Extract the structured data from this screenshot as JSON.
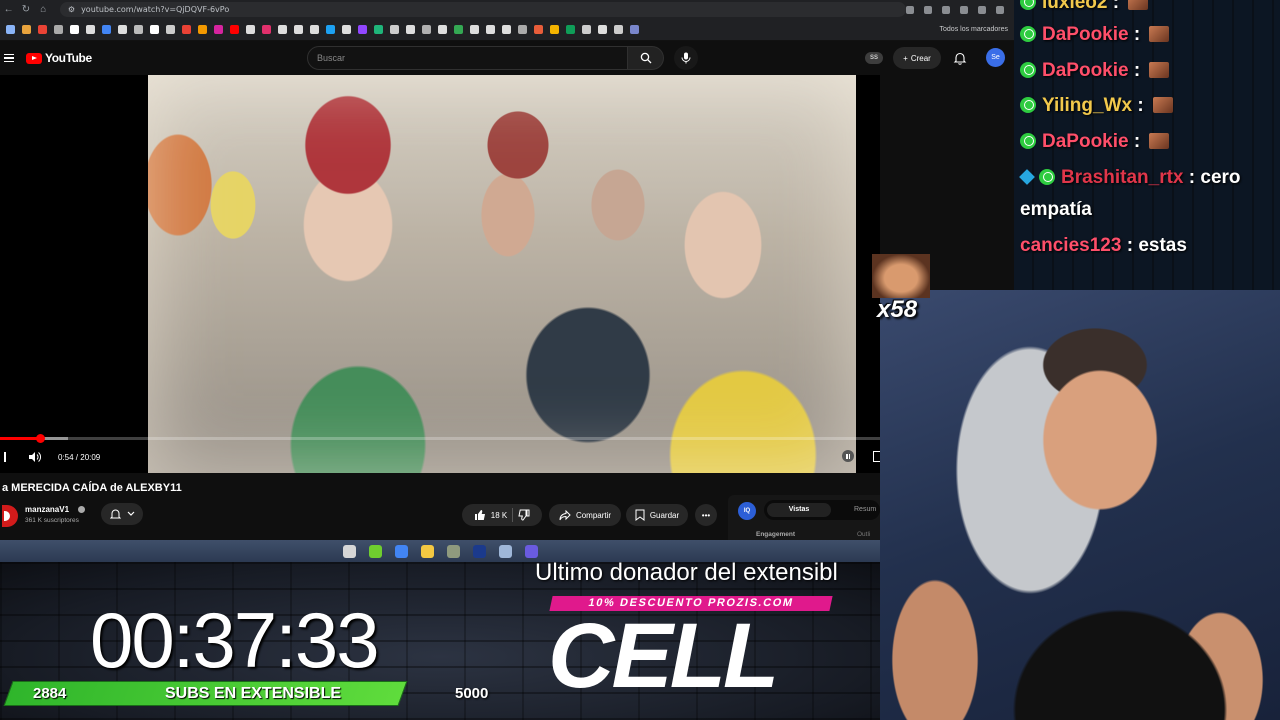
{
  "browser": {
    "url": "youtube.com/watch?v=QjDQVF-6vPo",
    "bookmarks_all": "Todos los marcadores",
    "bookmark_colors": [
      "#8ab4f8",
      "#e8a33d",
      "#ea4335",
      "#aaaaaa",
      "#ffffff",
      "#dddddd",
      "#4285f4",
      "#dddddd",
      "#bbbbbb",
      "#ffffff",
      "#cccccc",
      "#e94235",
      "#f29900",
      "#d6249f",
      "#ff0000",
      "#dddddd",
      "#e1306c",
      "#dddddd",
      "#dddddd",
      "#dddddd",
      "#1da1f2",
      "#dddddd",
      "#9146ff",
      "#1fb57a",
      "#cccccc",
      "#dddddd",
      "#b0b0b0",
      "#dddddd",
      "#34a853",
      "#dddddd",
      "#dddddd",
      "#dddddd",
      "#aaaaaa",
      "#e85d3a",
      "#f4b400",
      "#0f9d58",
      "#cccccc",
      "#dddddd",
      "#cccccc",
      "#7986cb"
    ]
  },
  "youtube": {
    "logo_text": "YouTube",
    "search_placeholder": "Buscar",
    "ss_badge": "SS",
    "create_label": "Crear",
    "avatar_initials": "Se",
    "player": {
      "time": "0:54 / 20:09",
      "progress_fraction": 0.045,
      "buffer_fraction": 0.077
    },
    "video_title": "a MERECIDA CAÍDA de ALEXBY11",
    "channel": {
      "name": "manzanaV1",
      "subscribers": "361 K suscriptores"
    },
    "actions": {
      "likes": "18 K",
      "share": "Compartir",
      "save": "Guardar"
    },
    "stats_panel": {
      "icon": "IQ",
      "tab_active": "Vistas",
      "tab_inactive": "Resum",
      "sub1": "Engagement",
      "sub2": "Outli"
    }
  },
  "taskbar": {
    "app_colors": [
      "#d6d6d6",
      "#6fce2f",
      "#4285f4",
      "#f4c842",
      "#8f9a7e",
      "#1b3a8c",
      "#9fb7d9",
      "#6a5be0"
    ]
  },
  "overlay": {
    "timer": "00:37:33",
    "subs_current": "2884",
    "subs_label": "SUBS EN EXTENSIBLE",
    "subs_goal": "5000",
    "donor_text": "Ultimo donador del extensibl",
    "promo": "10% DESCUENTO PROZIS.COM",
    "donor_name": "CELL"
  },
  "chat": {
    "messages": [
      {
        "user": "luxleo2",
        "color": "#f2c94c",
        "text": "",
        "emote": true
      },
      {
        "user": "DaPookie",
        "color": "#ff4f6a",
        "text": "",
        "emote": true
      },
      {
        "user": "DaPookie",
        "color": "#ff4f6a",
        "text": "",
        "emote": true
      },
      {
        "user": "Yiling_Wx",
        "color": "#f2c94c",
        "text": "",
        "emote": true
      },
      {
        "user": "DaPookie",
        "color": "#ff4f6a",
        "text": "",
        "emote": true
      },
      {
        "user": "Brashitan_rtx",
        "color": "#e0364a",
        "text": "cero",
        "emote": false
      },
      {
        "user": "",
        "color": "#ffffff",
        "text": "empatía",
        "emote": false
      },
      {
        "user": "cancies123",
        "color": "#ff4f6a",
        "text": "estas",
        "emote": false
      }
    ]
  },
  "emote_overlay": {
    "count": "x58"
  }
}
